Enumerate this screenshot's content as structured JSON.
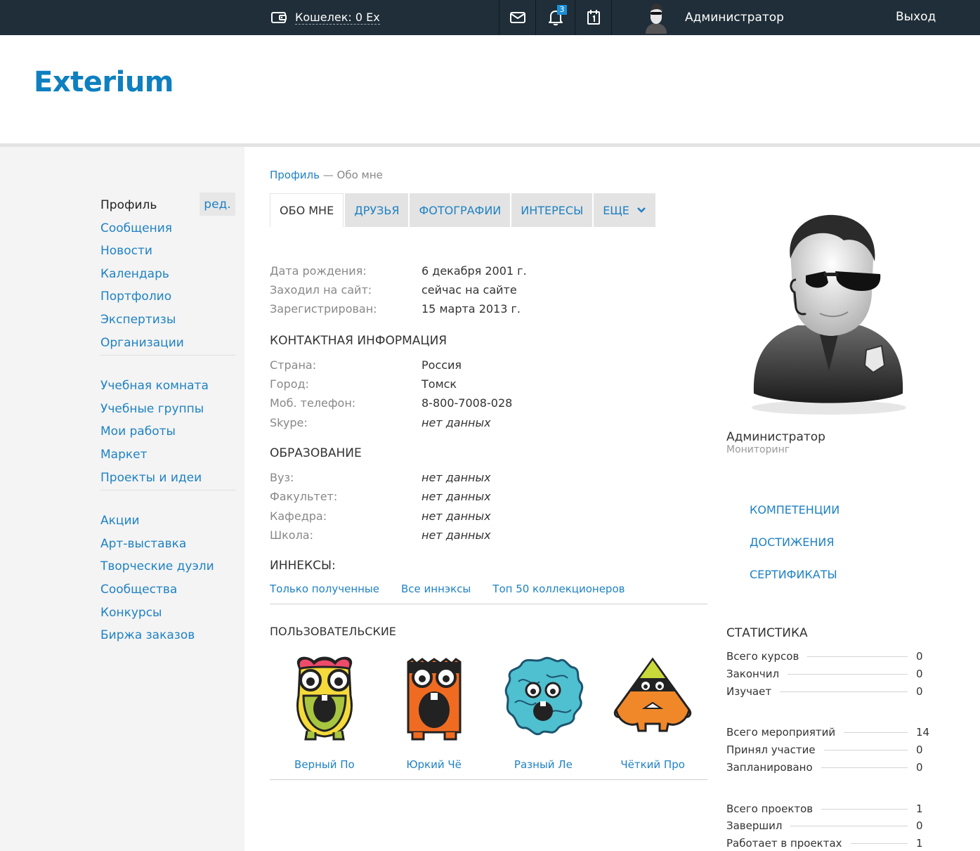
{
  "topbar": {
    "wallet": "Кошелек: 0 Ех",
    "notifications_count": "3",
    "user_name": "Администратор",
    "logout": "Выход"
  },
  "header": {
    "logo": "Exterium"
  },
  "sidebar": {
    "edit": "ред.",
    "group1": [
      "Профиль",
      "Сообщения",
      "Новости",
      "Календарь",
      "Портфолио",
      "Экспертизы",
      "Организации"
    ],
    "group2": [
      "Учебная комната",
      "Учебные группы",
      "Мои работы",
      "Маркет",
      "Проекты и идеи"
    ],
    "group3": [
      "Акции",
      "Арт-выставка",
      "Творческие дуэли",
      "Сообщества",
      "Конкурсы",
      "Биржа заказов"
    ]
  },
  "breadcrumb": {
    "link": "Профиль",
    "sep": " — ",
    "current": "Обо мне"
  },
  "tabs": [
    "ОБО МНЕ",
    "ДРУЗЬЯ",
    "ФОТОГРАФИИ",
    "ИНТЕРЕСЫ",
    "ЕЩЕ"
  ],
  "profile": {
    "birth_label": "Дата рождения:",
    "birth_value": "6 декабря 2001 г.",
    "seen_label": "Заходил на сайт:",
    "seen_value": "сейчас на сайте",
    "reg_label": "Зарегистрирован:",
    "reg_value": "15 марта 2013 г."
  },
  "contact": {
    "title": "КОНТАКТНАЯ ИНФОРМАЦИЯ",
    "country_label": "Страна:",
    "country_value": "Россия",
    "city_label": "Город:",
    "city_value": "Томск",
    "phone_label": "Моб. телефон:",
    "phone_value": "8-800-7008-028",
    "skype_label": "Skype:",
    "skype_value": "нет данных"
  },
  "education": {
    "title": "ОБРАЗОВАНИЕ",
    "uni_label": "Вуз:",
    "uni_value": "нет данных",
    "fac_label": "Факультет:",
    "fac_value": "нет данных",
    "dep_label": "Кафедра:",
    "dep_value": "нет данных",
    "school_label": "Школа:",
    "school_value": "нет данных"
  },
  "innex": {
    "title": "ИННЕКСЫ:",
    "links": [
      "Только полученные",
      "Все иннэксы",
      "Топ 50 коллекционеров"
    ],
    "custom_title": "ПОЛЬЗОВАТЕЛЬСКИЕ",
    "badges": [
      "Верный По",
      "Юркий Чё",
      "Разный Ле",
      "Чёткий Про"
    ]
  },
  "right": {
    "name": "Администратор",
    "role": "Мониторинг",
    "links": [
      "КОМПЕТЕНЦИИ",
      "ДОСТИЖЕНИЯ",
      "СЕРТИФИКАТЫ"
    ]
  },
  "stats": {
    "title": "СТАТИСТИКА",
    "rows": [
      {
        "label": "Всего курсов",
        "value": "0"
      },
      {
        "label": "Закончил",
        "value": "0"
      },
      {
        "label": "Изучает",
        "value": "0"
      },
      {
        "label": "Всего мероприятий",
        "value": "14"
      },
      {
        "label": "Принял участие",
        "value": "0"
      },
      {
        "label": "Запланировано",
        "value": "0"
      },
      {
        "label": "Всего проектов",
        "value": "1"
      },
      {
        "label": "Завершил",
        "value": "0"
      },
      {
        "label": "Работает в проектах",
        "value": "1"
      }
    ]
  },
  "icons": {
    "wallet": "wallet-icon",
    "mail": "mail-icon",
    "bell": "bell-icon",
    "calendar": "calendar-icon",
    "chevron": "chevron-down-icon"
  },
  "colors": {
    "topbar": "#1f2e38",
    "accent": "#1f82c3",
    "logo": "#0e7fbf",
    "badge": "#1a8fd6"
  }
}
